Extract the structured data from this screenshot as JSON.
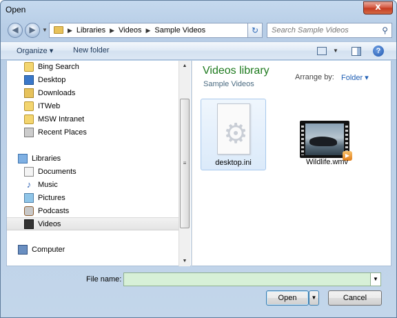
{
  "window": {
    "title": "Open",
    "close_label": "x"
  },
  "nav": {
    "back_glyph": "◀",
    "forward_glyph": "▶",
    "breadcrumbs": [
      "Libraries",
      "Videos",
      "Sample Videos"
    ],
    "search_placeholder": "Search Sample Videos"
  },
  "toolbar": {
    "organize": "Organize ▾",
    "new_folder": "New folder",
    "help": "?"
  },
  "sidebar": {
    "items": [
      {
        "label": "Bing Search",
        "icon": "link-icon"
      },
      {
        "label": "Desktop",
        "icon": "desktop-icon"
      },
      {
        "label": "Downloads",
        "icon": "downloads-icon"
      },
      {
        "label": "ITWeb",
        "icon": "link-icon"
      },
      {
        "label": "MSW Intranet",
        "icon": "link-icon"
      },
      {
        "label": "Recent Places",
        "icon": "recent-places-icon"
      },
      {
        "label": "Libraries",
        "icon": "libraries-icon"
      },
      {
        "label": "Documents",
        "icon": "documents-icon"
      },
      {
        "label": "Music",
        "icon": "music-icon"
      },
      {
        "label": "Pictures",
        "icon": "pictures-icon"
      },
      {
        "label": "Podcasts",
        "icon": "podcasts-icon"
      },
      {
        "label": "Videos",
        "icon": "videos-icon",
        "selected": true
      },
      {
        "label": "Computer",
        "icon": "computer-icon"
      }
    ]
  },
  "content": {
    "library_title": "Videos library",
    "library_subtitle": "Sample Videos",
    "arrange_label": "Arrange by:",
    "arrange_value": "Folder ▾",
    "files": [
      {
        "name": "desktop.ini",
        "icon": "settings-file-icon",
        "selected": true
      },
      {
        "name": "Wildlife.wmv",
        "icon": "video-thumbnail-icon"
      }
    ]
  },
  "footer": {
    "file_name_label": "File name:",
    "file_name_value": "",
    "open_button": "Open",
    "cancel_button": "Cancel"
  }
}
